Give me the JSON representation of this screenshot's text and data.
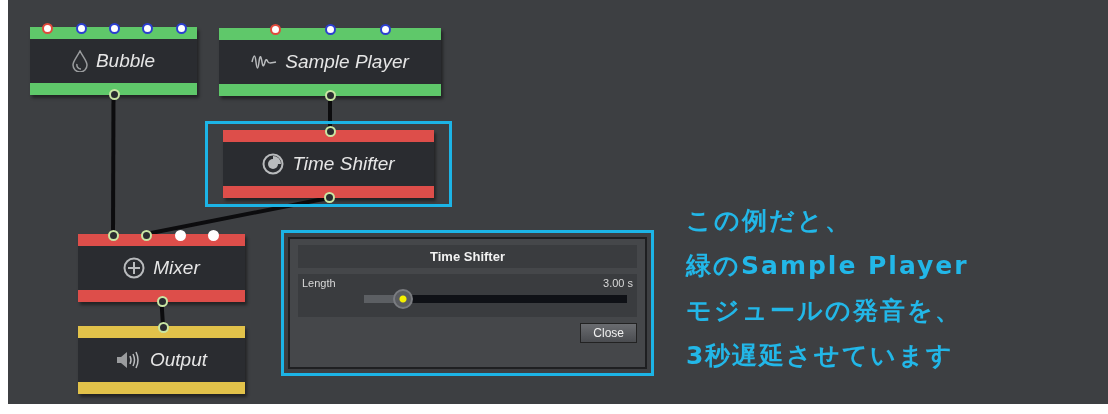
{
  "nodes": [
    {
      "name": "Bubble",
      "color": "#5fc86a",
      "highlighted": false,
      "ports": [
        {
          "color": "#e04a3c",
          "connected": false
        },
        {
          "color": "#2c3fd0",
          "connected": false
        },
        {
          "color": "#2c3fd0",
          "connected": false
        },
        {
          "color": "#2c3fd0",
          "connected": false
        },
        {
          "color": "#2c3fd0",
          "connected": false
        }
      ],
      "output_port": {
        "color": "#c9e6a3",
        "connected": true
      }
    },
    {
      "name": "Sample Player",
      "color": "#5fc86a",
      "highlighted": false,
      "ports": [
        {
          "color": "#e04a3c",
          "connected": false
        },
        {
          "color": "#2c3fd0",
          "connected": false
        },
        {
          "color": "#2c3fd0",
          "connected": false
        }
      ],
      "output_port": {
        "color": "#c9e6a3",
        "connected": true
      }
    },
    {
      "name": "Time Shifter",
      "color": "#dd4e4a",
      "highlighted": true,
      "ports": [
        {
          "color": "#c9e6a3",
          "connected": true
        }
      ],
      "output_port": {
        "color": "#c9e6a3",
        "connected": true
      }
    },
    {
      "name": "Mixer",
      "color": "#dd4e4a",
      "highlighted": false,
      "ports": [
        {
          "color": "#c9e6a3",
          "connected": true
        },
        {
          "color": "#c9e6a3",
          "connected": true
        },
        {
          "color": "#ffffff",
          "connected": false
        },
        {
          "color": "#ffffff",
          "connected": false
        }
      ],
      "output_port": {
        "color": "#c9e6a3",
        "connected": true
      }
    },
    {
      "name": "Output",
      "color": "#e2c24a",
      "highlighted": false,
      "ports": [
        {
          "color": "#c9e6a3",
          "connected": true
        }
      ]
    }
  ],
  "dialog": {
    "title": "Time Shifter",
    "highlighted": true,
    "param": {
      "label": "Length",
      "reading": "3.00 s",
      "level": 0.15
    },
    "button": "Close"
  },
  "caption": [
    "この例だと、",
    "緑のSample Player",
    "モジュールの発音を、",
    "3秒遅延させています"
  ]
}
